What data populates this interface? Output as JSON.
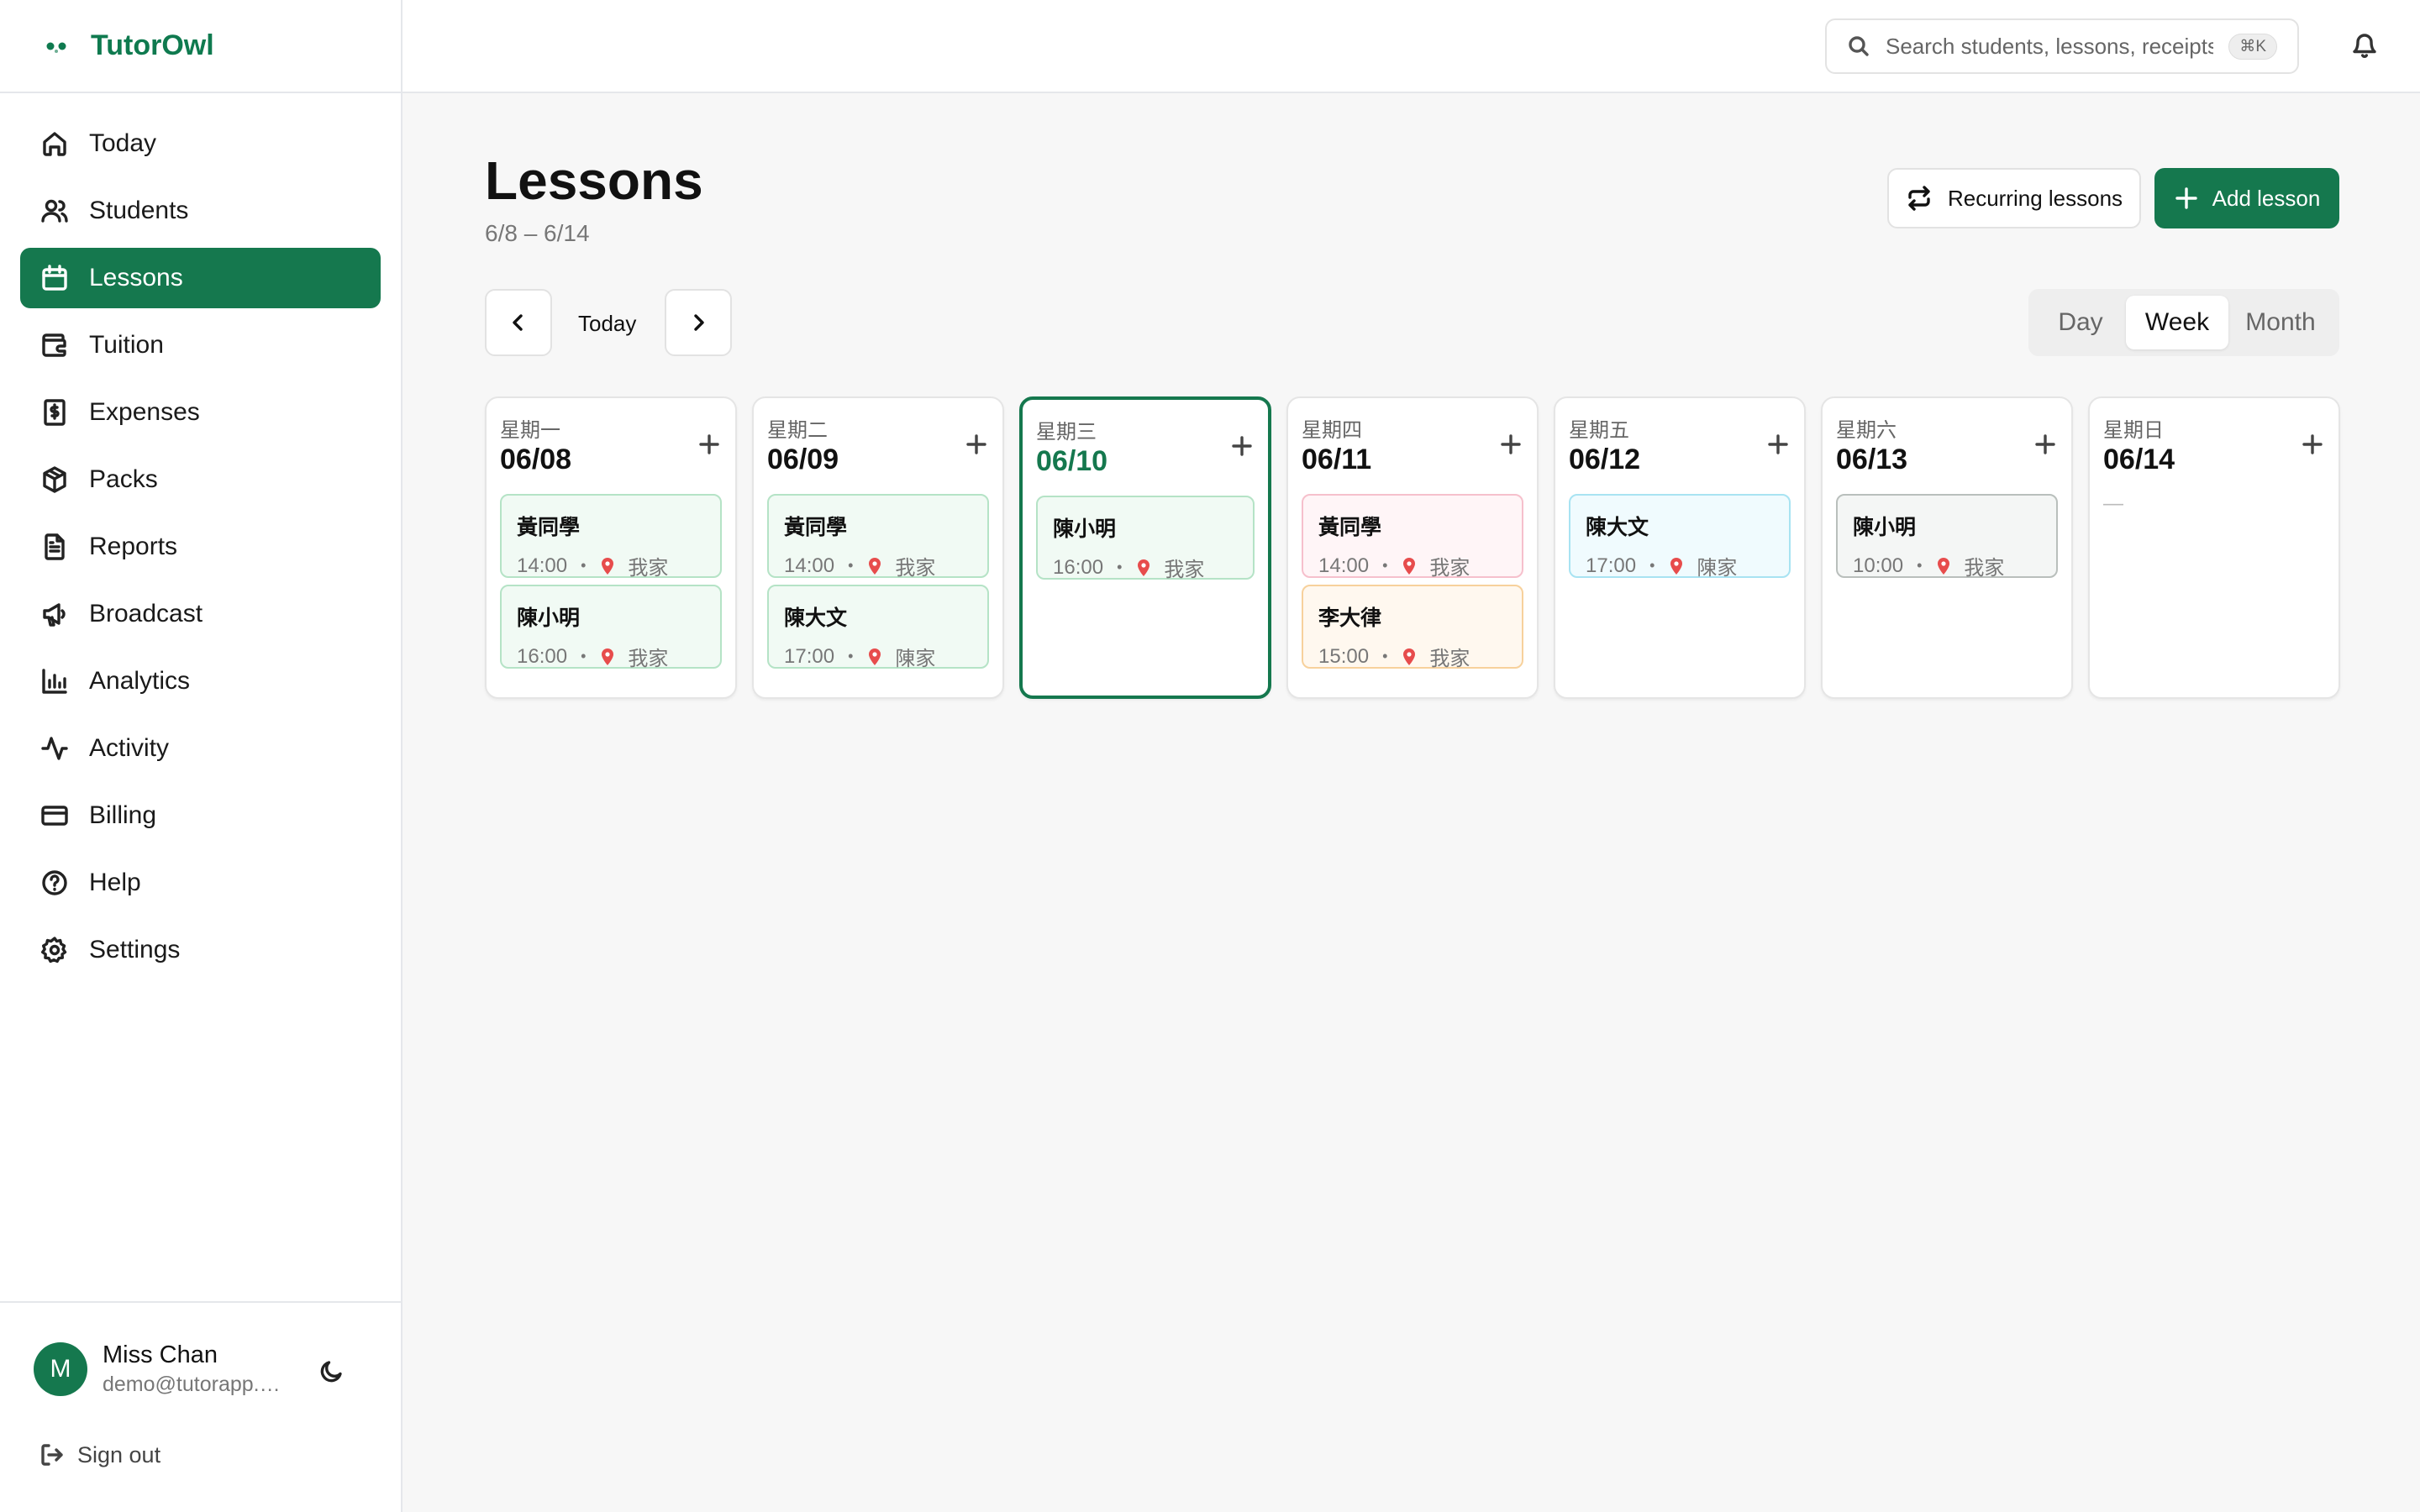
{
  "app": {
    "name": "TutorOwl",
    "brand_color": "#15784e"
  },
  "sidebar": {
    "items": [
      {
        "label": "Today",
        "icon": "home-icon"
      },
      {
        "label": "Students",
        "icon": "users-icon"
      },
      {
        "label": "Lessons",
        "icon": "calendar-icon",
        "active": true
      },
      {
        "label": "Tuition",
        "icon": "wallet-icon"
      },
      {
        "label": "Expenses",
        "icon": "receipt-icon"
      },
      {
        "label": "Packs",
        "icon": "package-icon"
      },
      {
        "label": "Reports",
        "icon": "file-icon"
      },
      {
        "label": "Broadcast",
        "icon": "megaphone-icon"
      },
      {
        "label": "Analytics",
        "icon": "bar-chart-icon"
      },
      {
        "label": "Activity",
        "icon": "activity-icon"
      },
      {
        "label": "Billing",
        "icon": "credit-card-icon"
      },
      {
        "label": "Help",
        "icon": "help-circle-icon"
      },
      {
        "label": "Settings",
        "icon": "gear-icon"
      }
    ],
    "user": {
      "initial": "M",
      "name": "Miss Chan",
      "email": "demo@tutorapp.com"
    },
    "sign_out": "Sign out"
  },
  "topbar": {
    "search_placeholder": "Search students, lessons, receipts…",
    "shortcut": "⌘K"
  },
  "page": {
    "title": "Lessons",
    "subtitle": "6/8 – 6/14",
    "recurring_label": "Recurring lessons",
    "add_label": "Add lesson",
    "today_label": "Today",
    "views": [
      "Day",
      "Week",
      "Month"
    ],
    "active_view": "Week"
  },
  "week": {
    "days": [
      {
        "name": "星期一",
        "date": "06/08",
        "today": false,
        "lessons": [
          {
            "student": "黃同學",
            "time": "14:00",
            "place": "我家",
            "tone": "green"
          },
          {
            "student": "陳小明",
            "time": "16:00",
            "place": "我家",
            "tone": "green"
          }
        ]
      },
      {
        "name": "星期二",
        "date": "06/09",
        "today": false,
        "lessons": [
          {
            "student": "黃同學",
            "time": "14:00",
            "place": "我家",
            "tone": "green"
          },
          {
            "student": "陳大文",
            "time": "17:00",
            "place": "陳家",
            "tone": "green"
          }
        ]
      },
      {
        "name": "星期三",
        "date": "06/10",
        "today": true,
        "lessons": [
          {
            "student": "陳小明",
            "time": "16:00",
            "place": "我家",
            "tone": "green"
          }
        ]
      },
      {
        "name": "星期四",
        "date": "06/11",
        "today": false,
        "lessons": [
          {
            "student": "黃同學",
            "time": "14:00",
            "place": "我家",
            "tone": "pink"
          },
          {
            "student": "李大律",
            "time": "15:00",
            "place": "我家",
            "tone": "orange"
          }
        ]
      },
      {
        "name": "星期五",
        "date": "06/12",
        "today": false,
        "lessons": [
          {
            "student": "陳大文",
            "time": "17:00",
            "place": "陳家",
            "tone": "cyan"
          }
        ]
      },
      {
        "name": "星期六",
        "date": "06/13",
        "today": false,
        "lessons": [
          {
            "student": "陳小明",
            "time": "10:00",
            "place": "我家",
            "tone": "gray"
          }
        ]
      },
      {
        "name": "星期日",
        "date": "06/14",
        "today": false,
        "empty_mark": "—",
        "lessons": []
      }
    ]
  },
  "tones": {
    "green": {
      "bg": "#f1faf4",
      "border": "#b5e3c6"
    },
    "pink": {
      "bg": "#fff5f7",
      "border": "#f6c0cc"
    },
    "orange": {
      "bg": "#fff8ef",
      "border": "#f7d19c"
    },
    "cyan": {
      "bg": "#f0fbfe",
      "border": "#a8e3f2"
    },
    "gray": {
      "bg": "#f4f6f5",
      "border": "#b9bfbc"
    }
  }
}
